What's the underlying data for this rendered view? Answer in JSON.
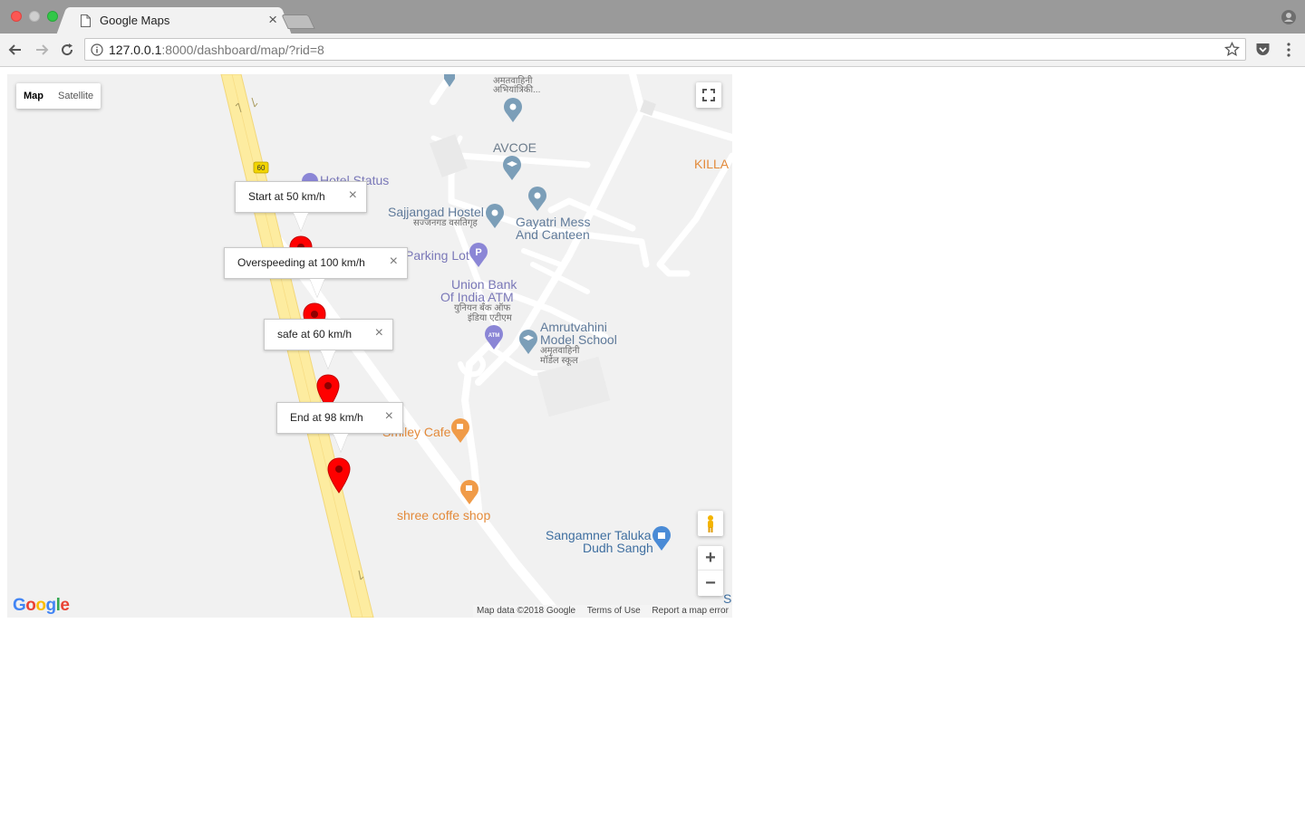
{
  "browser": {
    "tab_title": "Google Maps",
    "tab_close": "×",
    "url_host": "127.0.0.1",
    "url_rest": ":8000/dashboard/map/?rid=8"
  },
  "map": {
    "type_buttons": [
      "Map",
      "Satellite"
    ],
    "zoom_in": "+",
    "zoom_out": "−",
    "logo": "Google",
    "attribution": {
      "data": "Map data ©2018 Google",
      "terms": "Terms of Use",
      "report": "Report a map error"
    },
    "road_shield": "60",
    "places": [
      {
        "name": "अमतवाहिनी"
      },
      {
        "name": "अभियांत्रिकी..."
      },
      {
        "name": "AVCOE"
      },
      {
        "name": "Hotel Status"
      },
      {
        "name": "KILLA"
      },
      {
        "name": "Sajjangad Hostel"
      },
      {
        "name": "सज्जनगड वसतिगृह"
      },
      {
        "name": "Gayatri Mess"
      },
      {
        "name": "And Canteen"
      },
      {
        "name": "Parking Lot"
      },
      {
        "name": "Union Bank"
      },
      {
        "name": "Of India ATM"
      },
      {
        "name": "युनियन बँक ऑफ"
      },
      {
        "name": "इंडिया एटीएम"
      },
      {
        "name": "Amrutvahini"
      },
      {
        "name": "Model School"
      },
      {
        "name": "अमृतवाहिनी"
      },
      {
        "name": "मॉडेल स्कूल"
      },
      {
        "name": "Smiley Cafe"
      },
      {
        "name": "shree coffe shop"
      },
      {
        "name": "Sangamner Taluka"
      },
      {
        "name": "Dudh Sangh"
      },
      {
        "name": "S"
      }
    ],
    "info_windows": [
      {
        "text": "Start at 50 km/h",
        "close": "×"
      },
      {
        "text": "Overspeeding at 100 km/h",
        "close": "×"
      },
      {
        "text": "safe at 60 km/h",
        "close": "×"
      },
      {
        "text": "End at 98 km/h",
        "close": "×"
      }
    ],
    "colors": {
      "marker": "#ff0000",
      "highway": "#fdeca0",
      "poi_blue": "#7b9eb8",
      "poi_orange": "#f09b48"
    }
  }
}
